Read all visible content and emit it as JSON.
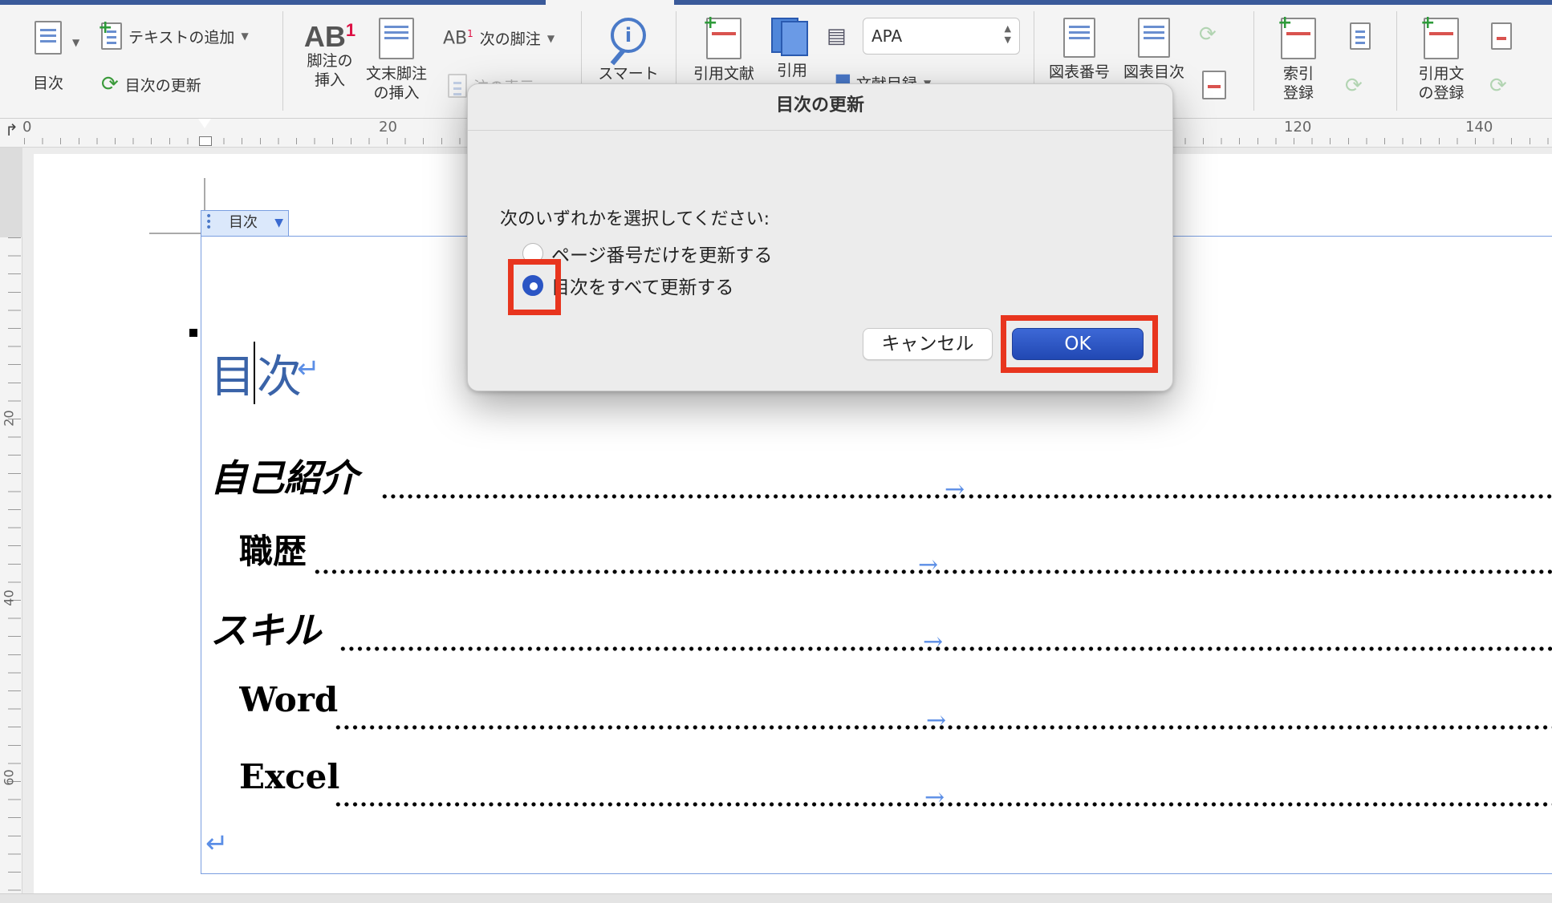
{
  "ribbon": {
    "toc": "目次",
    "add_text": "テキストの追加",
    "update_toc": "目次の更新",
    "insert_footnote_l1": "脚注の",
    "insert_footnote_l2": "挿入",
    "insert_endnote_l1": "文末脚注",
    "insert_endnote_l2": "の挿入",
    "next_footnote": "次の脚注",
    "show_notes": "注の表示",
    "smart_lookup": "スマート",
    "insert_citation": "引用文献",
    "citations": "引用",
    "bibliography": "文献目録",
    "style_value": "APA",
    "insert_caption": "図表番号",
    "table_of_figures": "図表目次",
    "mark_entry_l1": "索引",
    "mark_entry_l2": "登録",
    "mark_citation_l1": "引用文",
    "mark_citation_l2": "の登録",
    "ab_label": "AB",
    "ab_sup": "1"
  },
  "ruler": {
    "h_labels": [
      "0",
      "20",
      "120",
      "140"
    ],
    "v_labels": [
      "20",
      "40",
      "60"
    ]
  },
  "document": {
    "toc_tab_label": "目次",
    "toc_title": "目次",
    "entries": [
      {
        "text": "自己紹介",
        "level": 1
      },
      {
        "text": "職歴",
        "level": 2
      },
      {
        "text": "スキル",
        "level": 1
      },
      {
        "text": "Word",
        "level": 2
      },
      {
        "text": "Excel",
        "level": 2
      }
    ],
    "return_glyph": "↵",
    "tab_glyph": "→"
  },
  "dialog": {
    "title": "目次の更新",
    "prompt": "次のいずれかを選択してください:",
    "options": [
      {
        "label": "ページ番号だけを更新する",
        "selected": false
      },
      {
        "label": "目次をすべて更新する",
        "selected": true
      }
    ],
    "cancel_label": "キャンセル",
    "ok_label": "OK"
  },
  "colors": {
    "accent": "#2b55c4",
    "highlight": "#e8351e",
    "toc_title": "#3a63a8"
  }
}
